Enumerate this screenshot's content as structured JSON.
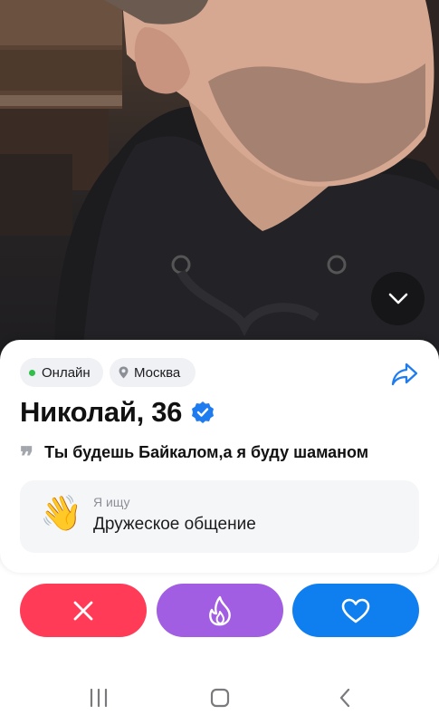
{
  "photo": {
    "expand_icon": "chevron-down-icon"
  },
  "profile": {
    "status": "Онлайн",
    "status_color": "#2fbf4a",
    "city": "Москва",
    "name_age": "Николай, 36",
    "verified": true,
    "verified_color": "#1f7cf0",
    "quote": "Ты будешь Байкалом,а я буду шаманом",
    "quote_icon": "99",
    "looking_label": "Я ищу",
    "looking_value": "Дружеское общение",
    "looking_icon": "👋"
  },
  "actions": {
    "skip_color": "#ff3b58",
    "super_color": "#a25ee2",
    "like_color": "#0f7ff0"
  }
}
